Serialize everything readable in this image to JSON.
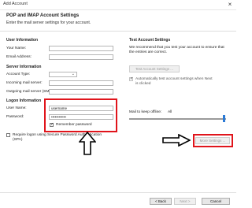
{
  "window": {
    "title": "Add Account",
    "close_glyph": "×"
  },
  "header": {
    "title": "POP and IMAP Account Settings",
    "subtitle": "Enter the mail server settings for your account."
  },
  "user_info": {
    "heading": "User Information",
    "your_name_label": "Your Name:",
    "email_label": "Email Address:"
  },
  "server_info": {
    "heading": "Server Information",
    "account_type_label": "Account Type:",
    "incoming_label": "Incoming mail server:",
    "outgoing_label": "Outgoing mail server (SMTP):"
  },
  "logon_info": {
    "heading": "Logon Information",
    "username_label": "User Name:",
    "username_value": "username",
    "password_label": "Password:",
    "password_value": "••••••••••••",
    "remember_label": "Remember password",
    "remember_checked": true,
    "spa_label_1": "Require logon using Secure Password Authentication",
    "spa_label_2": "(SPA)"
  },
  "test": {
    "heading": "Test Account Settings",
    "desc_1": "We recommend that you test your account to ensure that",
    "desc_2": "the entries are correct.",
    "test_button": "Test Account Settings ...",
    "auto_test_1": "Automatically test account settings when Next",
    "auto_test_2": "is clicked"
  },
  "offline": {
    "label": "Mail to keep offline:",
    "value": "All"
  },
  "more_settings_button": "More Settings ...",
  "footer": {
    "back": "< Back",
    "next": "Next >",
    "cancel": "Cancel"
  },
  "annotations": {
    "highlight_color": "#e0141b",
    "arrow_color": "#000000"
  }
}
